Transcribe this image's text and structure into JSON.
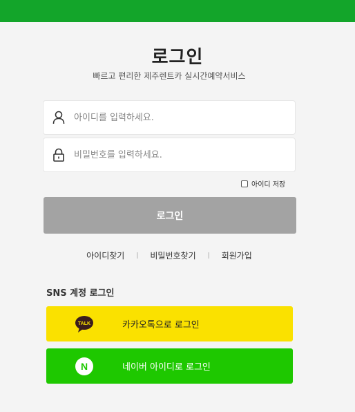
{
  "header": {
    "title": "로그인",
    "subtitle": "빠르고 편리한 제주렌트카 실시간예약서비스"
  },
  "form": {
    "id_placeholder": "아이디를 입력하세요.",
    "pw_placeholder": "비밀번호를 입력하세요.",
    "save_id_label": "아이디 저장",
    "save_id_checked": false,
    "login_button": "로그인"
  },
  "links": {
    "find_id": "아이디찾기",
    "find_pw": "비밀번호찾기",
    "signup": "회원가입",
    "separator": "|"
  },
  "sns": {
    "title": "SNS 계정 로그인",
    "kakao_label": "카카오톡으로 로그인",
    "kakao_logo_text": "TALK",
    "naver_label": "네이버 아이디로 로그인",
    "naver_logo_text": "N"
  },
  "colors": {
    "top_bar": "#13a52a",
    "kakao": "#fae100",
    "naver": "#1ec800",
    "login_button": "#a3a3a3"
  }
}
